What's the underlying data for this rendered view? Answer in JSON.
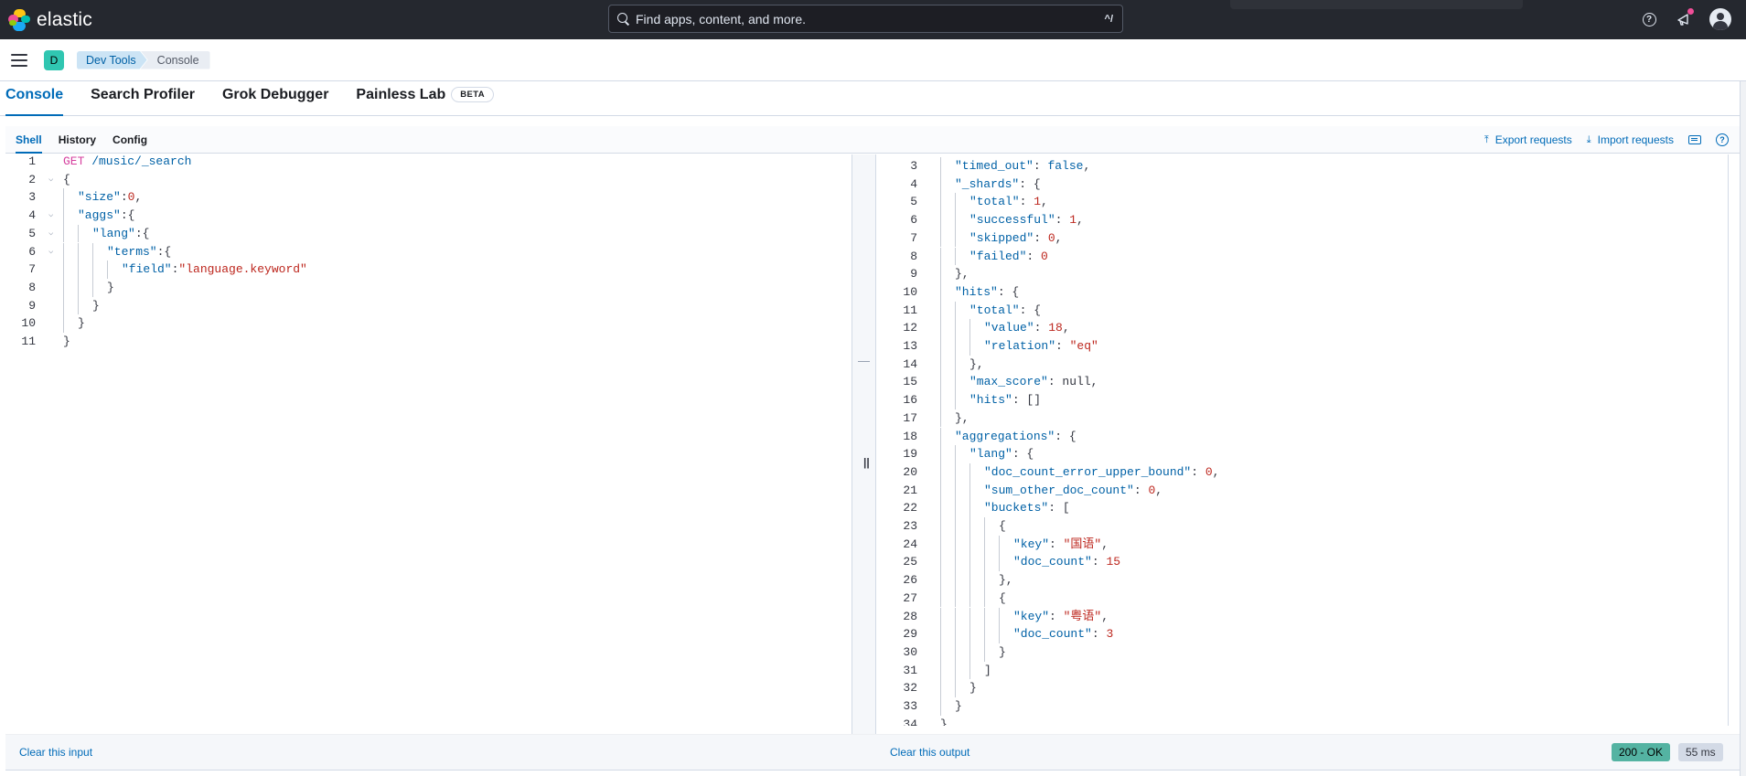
{
  "header": {
    "logo_text": "elastic",
    "search_placeholder": "Find apps, content, and more.",
    "search_shortcut": "^/",
    "help_icon": "?",
    "colors": {
      "header_bg": "#25282f",
      "accent": "#006bb8",
      "space_badge": "#30c6b1"
    }
  },
  "breadcrumb": {
    "space_initial": "D",
    "items": [
      "Dev Tools",
      "Console"
    ]
  },
  "app_tabs": [
    {
      "label": "Console",
      "active": true
    },
    {
      "label": "Search Profiler",
      "active": false
    },
    {
      "label": "Grok Debugger",
      "active": false
    },
    {
      "label": "Painless Lab",
      "active": false,
      "badge": "BETA"
    }
  ],
  "console": {
    "subtabs": [
      "Shell",
      "History",
      "Config"
    ],
    "actions": {
      "export": "Export requests",
      "import": "Import requests"
    }
  },
  "request": {
    "lines": [
      {
        "num": "1",
        "indent": 0,
        "tokens": [
          {
            "t": "GET",
            "c": "m"
          },
          {
            "t": " /music/_search",
            "c": "b"
          }
        ]
      },
      {
        "num": "2",
        "indent": 0,
        "fold": true,
        "tokens": [
          {
            "t": "{",
            "c": "key"
          }
        ]
      },
      {
        "num": "3",
        "indent": 1,
        "tokens": [
          {
            "t": "\"size\"",
            "c": "k"
          },
          {
            "t": ":",
            "c": "key"
          },
          {
            "t": "0",
            "c": "n"
          },
          {
            "t": ",",
            "c": "key"
          }
        ]
      },
      {
        "num": "4",
        "indent": 1,
        "fold": true,
        "tokens": [
          {
            "t": "\"aggs\"",
            "c": "k"
          },
          {
            "t": ":{",
            "c": "key"
          }
        ]
      },
      {
        "num": "5",
        "indent": 2,
        "fold": true,
        "tokens": [
          {
            "t": "\"lang\"",
            "c": "k"
          },
          {
            "t": ":{",
            "c": "key"
          }
        ]
      },
      {
        "num": "6",
        "indent": 3,
        "fold": true,
        "tokens": [
          {
            "t": "\"terms\"",
            "c": "k"
          },
          {
            "t": ":{",
            "c": "key"
          }
        ]
      },
      {
        "num": "7",
        "indent": 4,
        "tokens": [
          {
            "t": "\"field\"",
            "c": "k"
          },
          {
            "t": ":",
            "c": "key"
          },
          {
            "t": "\"language.keyword\"",
            "c": "s"
          }
        ]
      },
      {
        "num": "8",
        "indent": 3,
        "tokens": [
          {
            "t": "}",
            "c": "key"
          }
        ]
      },
      {
        "num": "9",
        "indent": 2,
        "tokens": [
          {
            "t": "}",
            "c": "key"
          }
        ]
      },
      {
        "num": "10",
        "indent": 1,
        "tokens": [
          {
            "t": "}",
            "c": "key"
          }
        ]
      },
      {
        "num": "11",
        "indent": 0,
        "tokens": [
          {
            "t": "}",
            "c": "key"
          }
        ]
      }
    ]
  },
  "response": {
    "lines": [
      {
        "num": "3",
        "indent": 1,
        "tokens": [
          {
            "t": "\"timed_out\"",
            "c": "k"
          },
          {
            "t": ": ",
            "c": "key"
          },
          {
            "t": "false",
            "c": "b"
          },
          {
            "t": ",",
            "c": "key"
          }
        ]
      },
      {
        "num": "4",
        "indent": 1,
        "tokens": [
          {
            "t": "\"_shards\"",
            "c": "k"
          },
          {
            "t": ": {",
            "c": "key"
          }
        ]
      },
      {
        "num": "5",
        "indent": 2,
        "tokens": [
          {
            "t": "\"total\"",
            "c": "k"
          },
          {
            "t": ": ",
            "c": "key"
          },
          {
            "t": "1",
            "c": "n"
          },
          {
            "t": ",",
            "c": "key"
          }
        ]
      },
      {
        "num": "6",
        "indent": 2,
        "tokens": [
          {
            "t": "\"successful\"",
            "c": "k"
          },
          {
            "t": ": ",
            "c": "key"
          },
          {
            "t": "1",
            "c": "n"
          },
          {
            "t": ",",
            "c": "key"
          }
        ]
      },
      {
        "num": "7",
        "indent": 2,
        "tokens": [
          {
            "t": "\"skipped\"",
            "c": "k"
          },
          {
            "t": ": ",
            "c": "key"
          },
          {
            "t": "0",
            "c": "n"
          },
          {
            "t": ",",
            "c": "key"
          }
        ]
      },
      {
        "num": "8",
        "indent": 2,
        "tokens": [
          {
            "t": "\"failed\"",
            "c": "k"
          },
          {
            "t": ": ",
            "c": "key"
          },
          {
            "t": "0",
            "c": "n"
          }
        ]
      },
      {
        "num": "9",
        "indent": 1,
        "tokens": [
          {
            "t": "},",
            "c": "key"
          }
        ]
      },
      {
        "num": "10",
        "indent": 1,
        "tokens": [
          {
            "t": "\"hits\"",
            "c": "k"
          },
          {
            "t": ": {",
            "c": "key"
          }
        ]
      },
      {
        "num": "11",
        "indent": 2,
        "tokens": [
          {
            "t": "\"total\"",
            "c": "k"
          },
          {
            "t": ": {",
            "c": "key"
          }
        ]
      },
      {
        "num": "12",
        "indent": 3,
        "tokens": [
          {
            "t": "\"value\"",
            "c": "k"
          },
          {
            "t": ": ",
            "c": "key"
          },
          {
            "t": "18",
            "c": "n"
          },
          {
            "t": ",",
            "c": "key"
          }
        ]
      },
      {
        "num": "13",
        "indent": 3,
        "tokens": [
          {
            "t": "\"relation\"",
            "c": "k"
          },
          {
            "t": ": ",
            "c": "key"
          },
          {
            "t": "\"eq\"",
            "c": "s"
          }
        ]
      },
      {
        "num": "14",
        "indent": 2,
        "tokens": [
          {
            "t": "},",
            "c": "key"
          }
        ]
      },
      {
        "num": "15",
        "indent": 2,
        "tokens": [
          {
            "t": "\"max_score\"",
            "c": "k"
          },
          {
            "t": ": null,",
            "c": "key"
          }
        ]
      },
      {
        "num": "16",
        "indent": 2,
        "tokens": [
          {
            "t": "\"hits\"",
            "c": "k"
          },
          {
            "t": ": []",
            "c": "key"
          }
        ]
      },
      {
        "num": "17",
        "indent": 1,
        "tokens": [
          {
            "t": "},",
            "c": "key"
          }
        ]
      },
      {
        "num": "18",
        "indent": 1,
        "tokens": [
          {
            "t": "\"aggregations\"",
            "c": "k"
          },
          {
            "t": ": {",
            "c": "key"
          }
        ]
      },
      {
        "num": "19",
        "indent": 2,
        "tokens": [
          {
            "t": "\"lang\"",
            "c": "k"
          },
          {
            "t": ": {",
            "c": "key"
          }
        ]
      },
      {
        "num": "20",
        "indent": 3,
        "tokens": [
          {
            "t": "\"doc_count_error_upper_bound\"",
            "c": "k"
          },
          {
            "t": ": ",
            "c": "key"
          },
          {
            "t": "0",
            "c": "n"
          },
          {
            "t": ",",
            "c": "key"
          }
        ]
      },
      {
        "num": "21",
        "indent": 3,
        "tokens": [
          {
            "t": "\"sum_other_doc_count\"",
            "c": "k"
          },
          {
            "t": ": ",
            "c": "key"
          },
          {
            "t": "0",
            "c": "n"
          },
          {
            "t": ",",
            "c": "key"
          }
        ]
      },
      {
        "num": "22",
        "indent": 3,
        "tokens": [
          {
            "t": "\"buckets\"",
            "c": "k"
          },
          {
            "t": ": [",
            "c": "key"
          }
        ]
      },
      {
        "num": "23",
        "indent": 4,
        "tokens": [
          {
            "t": "{",
            "c": "key"
          }
        ]
      },
      {
        "num": "24",
        "indent": 5,
        "tokens": [
          {
            "t": "\"key\"",
            "c": "k"
          },
          {
            "t": ": ",
            "c": "key"
          },
          {
            "t": "\"国语\"",
            "c": "s"
          },
          {
            "t": ",",
            "c": "key"
          }
        ]
      },
      {
        "num": "25",
        "indent": 5,
        "tokens": [
          {
            "t": "\"doc_count\"",
            "c": "k"
          },
          {
            "t": ": ",
            "c": "key"
          },
          {
            "t": "15",
            "c": "n"
          }
        ]
      },
      {
        "num": "26",
        "indent": 4,
        "tokens": [
          {
            "t": "},",
            "c": "key"
          }
        ]
      },
      {
        "num": "27",
        "indent": 4,
        "tokens": [
          {
            "t": "{",
            "c": "key"
          }
        ]
      },
      {
        "num": "28",
        "indent": 5,
        "tokens": [
          {
            "t": "\"key\"",
            "c": "k"
          },
          {
            "t": ": ",
            "c": "key"
          },
          {
            "t": "\"粤语\"",
            "c": "s"
          },
          {
            "t": ",",
            "c": "key"
          }
        ]
      },
      {
        "num": "29",
        "indent": 5,
        "tokens": [
          {
            "t": "\"doc_count\"",
            "c": "k"
          },
          {
            "t": ": ",
            "c": "key"
          },
          {
            "t": "3",
            "c": "n"
          }
        ]
      },
      {
        "num": "30",
        "indent": 4,
        "tokens": [
          {
            "t": "}",
            "c": "key"
          }
        ]
      },
      {
        "num": "31",
        "indent": 3,
        "tokens": [
          {
            "t": "]",
            "c": "key"
          }
        ]
      },
      {
        "num": "32",
        "indent": 2,
        "tokens": [
          {
            "t": "}",
            "c": "key"
          }
        ]
      },
      {
        "num": "33",
        "indent": 1,
        "tokens": [
          {
            "t": "}",
            "c": "key"
          }
        ]
      },
      {
        "num": "34",
        "indent": 0,
        "tokens": [
          {
            "t": "}",
            "c": "key"
          }
        ]
      }
    ]
  },
  "footer": {
    "clear_input": "Clear this input",
    "clear_output": "Clear this output",
    "status": "200 - OK",
    "duration": "55 ms"
  }
}
